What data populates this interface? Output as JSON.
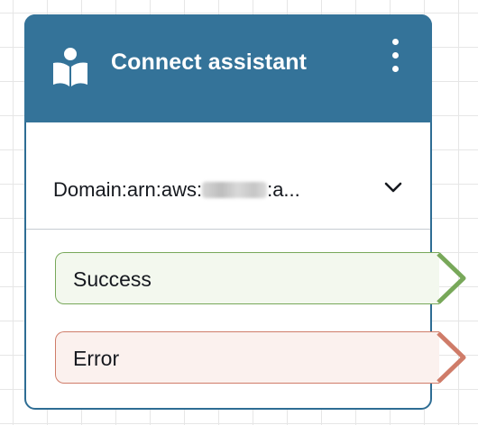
{
  "block": {
    "title": "Connect assistant",
    "icon": "person-reading-book-icon",
    "menu_icon": "vertical-ellipsis-icon"
  },
  "parameter": {
    "prefix": "Domain:arn:aws:",
    "suffix": ":a...",
    "dropdown_icon": "chevron-down-icon"
  },
  "branches": [
    {
      "label": "Success",
      "color": "#78a85a",
      "background": "#f3f8ee"
    },
    {
      "label": "Error",
      "color": "#cf7c69",
      "background": "#fbf1ee"
    }
  ],
  "colors": {
    "header": "#347399",
    "border": "#2e6d94",
    "input_connector": "#8a9aaa"
  }
}
